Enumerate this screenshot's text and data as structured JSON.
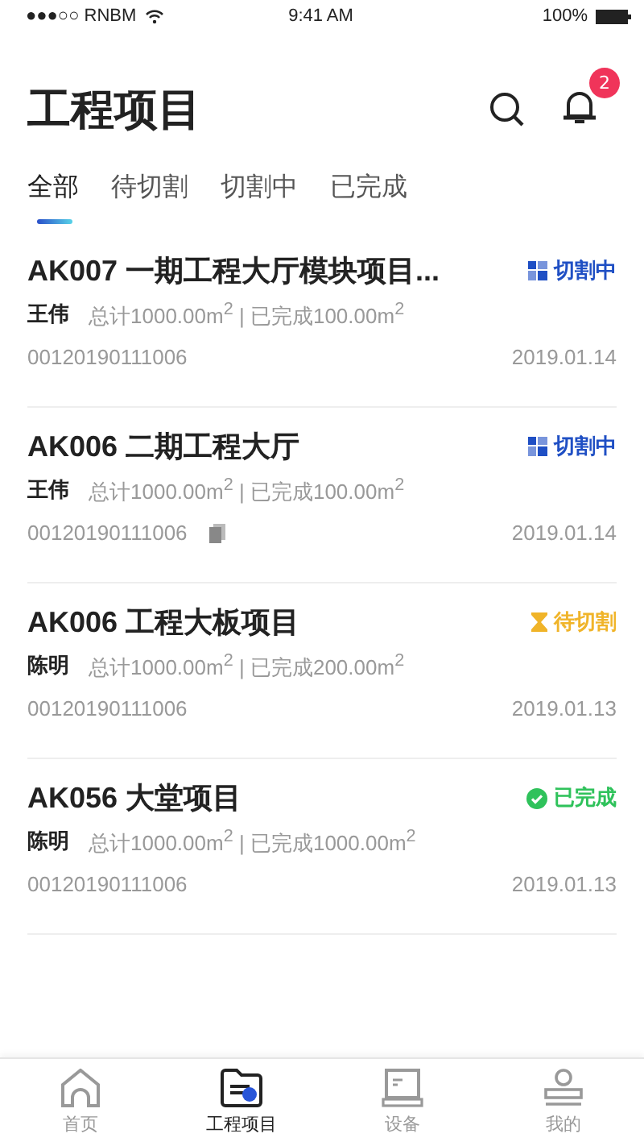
{
  "status_bar": {
    "carrier": "●●●○○ RNBM",
    "time": "9:41 AM",
    "battery": "100%"
  },
  "header": {
    "title": "工程项目",
    "notification_count": "2"
  },
  "tabs": [
    {
      "label": "全部",
      "selected": true
    },
    {
      "label": "待切割",
      "selected": false
    },
    {
      "label": "切割中",
      "selected": false
    },
    {
      "label": "已完成",
      "selected": false
    }
  ],
  "projects": [
    {
      "name": "AK007 一期工程大厅模块项目...",
      "status": {
        "kind": "cutting",
        "label": "切割中"
      },
      "owner": "王伟",
      "area": "总计1000.00m$^{2}$ | 已完成100.00m$^{2}$",
      "code": "00120190111006",
      "copy_icon": false,
      "date": "2019.01.14"
    },
    {
      "name": "AK006 二期工程大厅",
      "status": {
        "kind": "cutting",
        "label": "切割中"
      },
      "owner": "王伟",
      "area": "总计1000.00m$^{2}$ | 已完成100.00m$^{2}$",
      "code": "00120190111006",
      "copy_icon": true,
      "date": "2019.01.14"
    },
    {
      "name": "AK006 工程大板项目",
      "status": {
        "kind": "pending",
        "label": "待切割"
      },
      "owner": "陈明",
      "area": "总计1000.00m$^{2}$ | 已完成200.00m$^{2}$",
      "code": "00120190111006",
      "copy_icon": false,
      "date": "2019.01.13"
    },
    {
      "name": "AK056 大堂项目",
      "status": {
        "kind": "done",
        "label": "已完成"
      },
      "owner": "陈明",
      "area": "总计1000.00m$^{2}$ | 已完成1000.00m$^{2}$",
      "code": "00120190111006",
      "copy_icon": false,
      "date": "2019.01.13"
    }
  ],
  "bottom_nav": [
    {
      "kind": "home",
      "label": "首页",
      "selected": false
    },
    {
      "kind": "projects",
      "label": "工程项目",
      "selected": true
    },
    {
      "kind": "device",
      "label": "设备",
      "selected": false
    },
    {
      "kind": "profile",
      "label": "我的",
      "selected": false
    }
  ]
}
